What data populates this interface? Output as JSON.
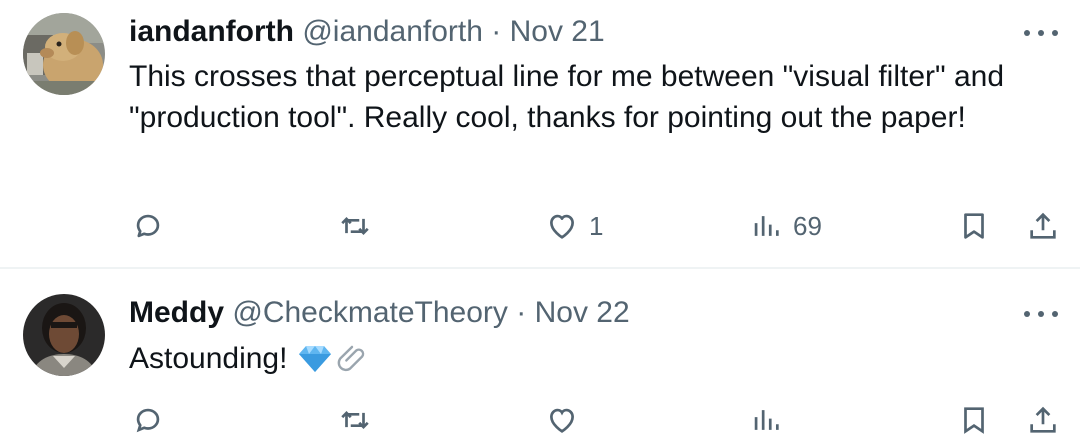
{
  "tweets": [
    {
      "name": "iandanforth",
      "handle": "@iandanforth",
      "separator": "·",
      "date": "Nov 21",
      "text": "This crosses that perceptual line for me between \"visual filter\" and \"production tool\". Really cool, thanks for pointing out the paper!",
      "actions": {
        "likes": "1",
        "views": "69"
      },
      "icons": {
        "avatar": "dog-photo-avatar",
        "more": "more-icon",
        "reply": "reply-icon",
        "retweet": "retweet-icon",
        "like": "heart-icon",
        "views": "views-icon",
        "bookmark": "bookmark-icon",
        "share": "share-icon"
      }
    },
    {
      "name": "Meddy",
      "handle": "@CheckmateTheory",
      "separator": "·",
      "date": "Nov 22",
      "text": "Astounding!",
      "emoji": [
        "gem-emoji",
        "paperclip-emoji"
      ],
      "icons": {
        "avatar": "person-photo-avatar",
        "more": "more-icon"
      }
    }
  ],
  "colors": {
    "text": "#0f1419",
    "secondary": "#536471",
    "divider": "#eff3f4",
    "gem": "#5fb6f0"
  }
}
